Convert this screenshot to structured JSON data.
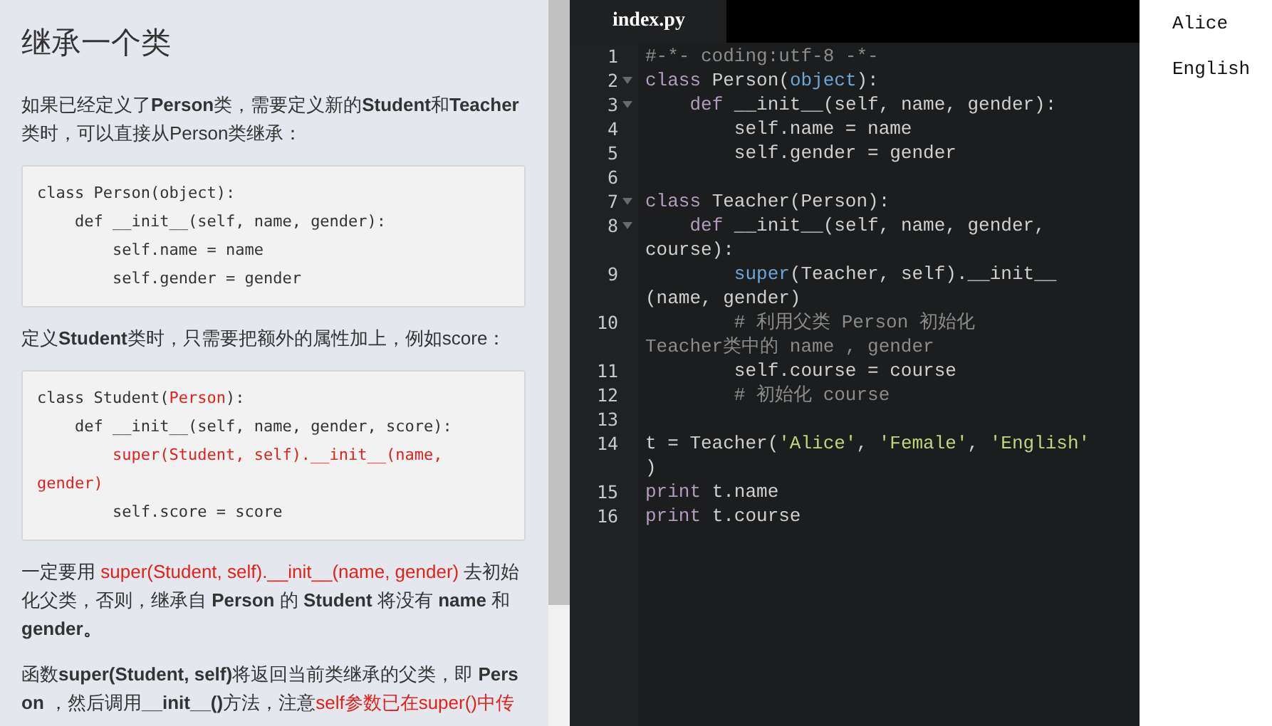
{
  "lesson": {
    "title": "继承一个类",
    "blocks": [
      {
        "kind": "para",
        "segments": [
          {
            "text": "如果已经定义了**Person**类，需要定义新的**Student**和**Teacher**类时，可以直接从Person类继承：",
            "highlighted": false
          }
        ]
      },
      {
        "kind": "code",
        "lines": [
          [
            {
              "text": "class Person(object):",
              "highlighted": false
            }
          ],
          [
            {
              "text": "    def __init__(self, name, gender):",
              "highlighted": false
            }
          ],
          [
            {
              "text": "        self.name = name",
              "highlighted": false
            }
          ],
          [
            {
              "text": "        self.gender = gender",
              "highlighted": false
            }
          ]
        ]
      },
      {
        "kind": "para",
        "segments": [
          {
            "text": "定义**Student**类时，只需要把额外的属性加上，例如score：",
            "highlighted": false
          }
        ]
      },
      {
        "kind": "code",
        "lines": [
          [
            {
              "text": "class Student(",
              "highlighted": false
            },
            {
              "text": "Person",
              "highlighted": true
            },
            {
              "text": "):",
              "highlighted": false
            }
          ],
          [
            {
              "text": "    def __init__(self, name, gender, score):",
              "highlighted": false
            }
          ],
          [
            {
              "text": "        super(Student, self).__init__(name, gender)",
              "highlighted": true
            }
          ],
          [
            {
              "text": "        self.score = score",
              "highlighted": false
            }
          ]
        ]
      },
      {
        "kind": "para",
        "segments": [
          {
            "text": "一定要用 ",
            "highlighted": false
          },
          {
            "text": "super(Student, self).__init__(name, gender)",
            "highlighted": true
          },
          {
            "text": " 去初始化父类，否则，继承自 **Person** 的 **Student** 将没有 **name** 和 **gender。**",
            "highlighted": false
          }
        ]
      },
      {
        "kind": "para",
        "segments": [
          {
            "text": "函数**super(Student, self)**将返回当前类继承的父类，即 **Person** ，然后调用**__init__()**方法，注意",
            "highlighted": false
          },
          {
            "text": "self参数已在super()中传",
            "highlighted": true
          }
        ]
      }
    ]
  },
  "editor": {
    "tab": "index.py",
    "lines": [
      {
        "number": "1",
        "foldable": false,
        "rows": [
          [
            {
              "kind": "comment",
              "text": "#-*- coding:utf-8 -*-"
            }
          ]
        ]
      },
      {
        "number": "2",
        "foldable": true,
        "rows": [
          [
            {
              "kind": "keyword",
              "text": "class"
            },
            {
              "kind": "plain",
              "text": " Person("
            },
            {
              "kind": "builtin",
              "text": "object"
            },
            {
              "kind": "plain",
              "text": "):"
            }
          ]
        ]
      },
      {
        "number": "3",
        "foldable": true,
        "rows": [
          [
            {
              "kind": "plain",
              "text": "    "
            },
            {
              "kind": "keyword",
              "text": "def"
            },
            {
              "kind": "plain",
              "text": " __init__(self, name, gender):"
            }
          ]
        ]
      },
      {
        "number": "4",
        "foldable": false,
        "rows": [
          [
            {
              "kind": "plain",
              "text": "        self.name = name"
            }
          ]
        ]
      },
      {
        "number": "5",
        "foldable": false,
        "rows": [
          [
            {
              "kind": "plain",
              "text": "        self.gender = gender"
            }
          ]
        ]
      },
      {
        "number": "6",
        "foldable": false
      },
      {
        "number": "7",
        "foldable": true,
        "rows": [
          [
            {
              "kind": "keyword",
              "text": "class"
            },
            {
              "kind": "plain",
              "text": " Teacher(Person):"
            }
          ]
        ]
      },
      {
        "number": "8",
        "foldable": true,
        "rows": [
          [
            {
              "kind": "plain",
              "text": "    "
            },
            {
              "kind": "keyword",
              "text": "def"
            },
            {
              "kind": "plain",
              "text": " __init__(self, name, gender,"
            }
          ],
          [
            {
              "kind": "plain",
              "text": "course):"
            }
          ]
        ]
      },
      {
        "number": "9",
        "foldable": false,
        "rows": [
          [
            {
              "kind": "plain",
              "text": "        "
            },
            {
              "kind": "builtin",
              "text": "super"
            },
            {
              "kind": "plain",
              "text": "(Teacher, self).__init__"
            }
          ],
          [
            {
              "kind": "plain",
              "text": "(name, gender)"
            }
          ]
        ]
      },
      {
        "number": "10",
        "foldable": false,
        "rows": [
          [
            {
              "kind": "comment",
              "text": "        # 利用父类 Person 初始化"
            }
          ],
          [
            {
              "kind": "comment",
              "text": "Teacher类中的 name , gender"
            }
          ]
        ]
      },
      {
        "number": "11",
        "foldable": false,
        "rows": [
          [
            {
              "kind": "plain",
              "text": "        self.course = course"
            }
          ]
        ]
      },
      {
        "number": "12",
        "foldable": false,
        "rows": [
          [
            {
              "kind": "comment",
              "text": "        # 初始化 course"
            }
          ]
        ]
      },
      {
        "number": "13",
        "foldable": false
      },
      {
        "number": "14",
        "foldable": false,
        "rows": [
          [
            {
              "kind": "plain",
              "text": "t = Teacher("
            },
            {
              "kind": "string",
              "text": "'Alice'"
            },
            {
              "kind": "plain",
              "text": ", "
            },
            {
              "kind": "string",
              "text": "'Female'"
            },
            {
              "kind": "plain",
              "text": ", "
            },
            {
              "kind": "string",
              "text": "'English'"
            }
          ],
          [
            {
              "kind": "plain",
              "text": ")"
            }
          ]
        ]
      },
      {
        "number": "15",
        "foldable": false,
        "rows": [
          [
            {
              "kind": "keyword",
              "text": "print"
            },
            {
              "kind": "plain",
              "text": " t.name"
            }
          ]
        ]
      },
      {
        "number": "16",
        "foldable": false,
        "rows": [
          [
            {
              "kind": "keyword",
              "text": "print"
            },
            {
              "kind": "plain",
              "text": " t.course"
            }
          ]
        ]
      }
    ]
  },
  "output": {
    "lines": [
      "Alice",
      "English"
    ]
  }
}
